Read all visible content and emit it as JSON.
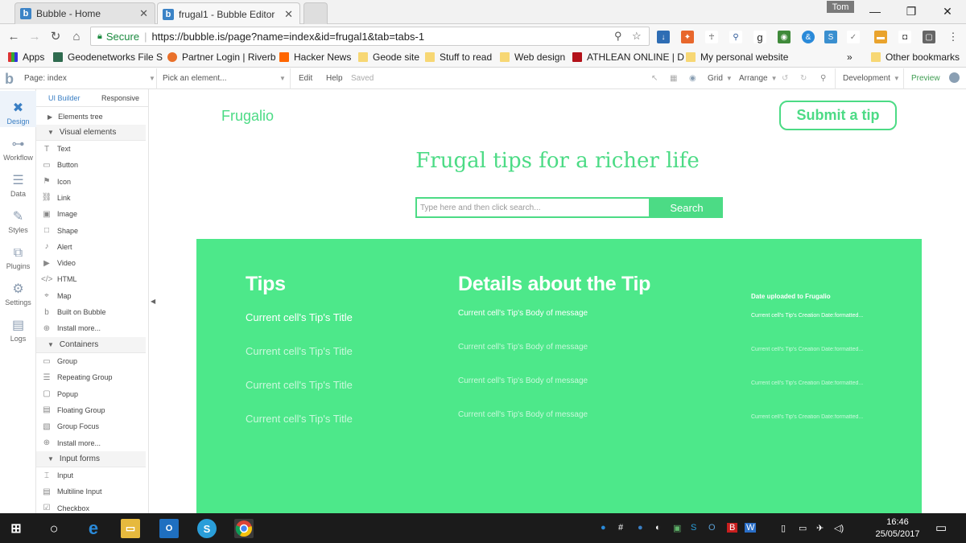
{
  "browser": {
    "tabs": [
      {
        "title": "Bubble - Home",
        "active": false
      },
      {
        "title": "frugal1 - Bubble Editor",
        "active": true
      }
    ],
    "profile": "Tom",
    "secure_label": "Secure",
    "url": "https://bubble.is/page?name=index&id=frugal1&tab=tabs-1",
    "bookmarks": [
      {
        "label": "Apps",
        "icon": "apps-grid-icon"
      },
      {
        "label": "Geodenetworks File S",
        "icon": "geode-icon"
      },
      {
        "label": "Partner Login | Riverb",
        "icon": "riverbed-icon"
      },
      {
        "label": "Hacker News",
        "icon": "hacker-news-icon"
      },
      {
        "label": "Geode site",
        "icon": "folder-icon"
      },
      {
        "label": "Stuff to read",
        "icon": "folder-icon"
      },
      {
        "label": "Web design",
        "icon": "folder-icon"
      },
      {
        "label": "ATHLEAN ONLINE | D",
        "icon": "athlean-icon"
      },
      {
        "label": "My personal website",
        "icon": "folder-icon"
      },
      {
        "label": "Other bookmarks",
        "icon": "folder-icon"
      }
    ],
    "bookmarks_overflow": "»"
  },
  "editor": {
    "page_select": "Page: index",
    "element_picker": "Pick an element...",
    "menu": [
      "Edit",
      "Help"
    ],
    "save_status": "Saved",
    "grid": "Grid",
    "arrange": "Arrange",
    "environment": "Development",
    "preview": "Preview",
    "rail": [
      {
        "label": "Design",
        "icon": "design-tools-icon",
        "active": true
      },
      {
        "label": "Workflow",
        "icon": "workflow-icon",
        "active": false
      },
      {
        "label": "Data",
        "icon": "database-icon",
        "active": false
      },
      {
        "label": "Styles",
        "icon": "brush-icon",
        "active": false
      },
      {
        "label": "Plugins",
        "icon": "plugins-icon",
        "active": false
      },
      {
        "label": "Settings",
        "icon": "gear-icon",
        "active": false
      },
      {
        "label": "Logs",
        "icon": "logs-icon",
        "active": false
      }
    ],
    "palette_tabs": [
      "UI Builder",
      "Responsive"
    ],
    "palette": {
      "elements_tree": "Elements tree",
      "visual_elements": "Visual elements",
      "visual_items": [
        {
          "label": "Text",
          "icon": "T"
        },
        {
          "label": "Button",
          "icon": "▭"
        },
        {
          "label": "Icon",
          "icon": "⚑"
        },
        {
          "label": "Link",
          "icon": "⛓"
        },
        {
          "label": "Image",
          "icon": "▣"
        },
        {
          "label": "Shape",
          "icon": "□"
        },
        {
          "label": "Alert",
          "icon": "♪"
        },
        {
          "label": "Video",
          "icon": "▶"
        },
        {
          "label": "HTML",
          "icon": "</>"
        },
        {
          "label": "Map",
          "icon": "⌖"
        },
        {
          "label": "Built on Bubble",
          "icon": "b"
        },
        {
          "label": "Install more...",
          "icon": "⊕"
        }
      ],
      "containers": "Containers",
      "container_items": [
        {
          "label": "Group",
          "icon": "▭"
        },
        {
          "label": "Repeating Group",
          "icon": "☰"
        },
        {
          "label": "Popup",
          "icon": "▢"
        },
        {
          "label": "Floating Group",
          "icon": "▤"
        },
        {
          "label": "Group Focus",
          "icon": "▧"
        },
        {
          "label": "Install more...",
          "icon": "⊕"
        }
      ],
      "input_forms": "Input forms",
      "input_items": [
        {
          "label": "Input",
          "icon": "⌶"
        },
        {
          "label": "Multiline Input",
          "icon": "▤"
        },
        {
          "label": "Checkbox",
          "icon": "☑"
        }
      ]
    }
  },
  "page": {
    "brand": "Frugalio",
    "submit_tip": "Submit a tip",
    "hero": "Frugal tips for a richer life",
    "search_placeholder": "Type here and then click search...",
    "search_button": "Search",
    "col_tips": "Tips",
    "col_details": "Details about the Tip",
    "col_date": "Date uploaded to Frugalio",
    "rows": [
      {
        "title": "Current cell's Tip's Title",
        "body": "Current cell's Tip's Body of message",
        "date": "Current cell's Tip's Creation Date:formatted..."
      },
      {
        "title": "Current cell's Tip's Title",
        "body": "Current cell's Tip's Body of message",
        "date": "Current cell's Tip's Creation Date:formatted..."
      },
      {
        "title": "Current cell's Tip's Title",
        "body": "Current cell's Tip's Body of message",
        "date": "Current cell's Tip's Creation Date:formatted..."
      },
      {
        "title": "Current cell's Tip's Title",
        "body": "Current cell's Tip's Body of message",
        "date": "Current cell's Tip's Creation Date:formatted..."
      }
    ]
  },
  "taskbar": {
    "time": "16:46",
    "date": "25/05/2017"
  },
  "colors": {
    "accent_green": "#4cdb85",
    "panel_green": "#4de88a",
    "bubble_blue": "#3a7fc4"
  }
}
